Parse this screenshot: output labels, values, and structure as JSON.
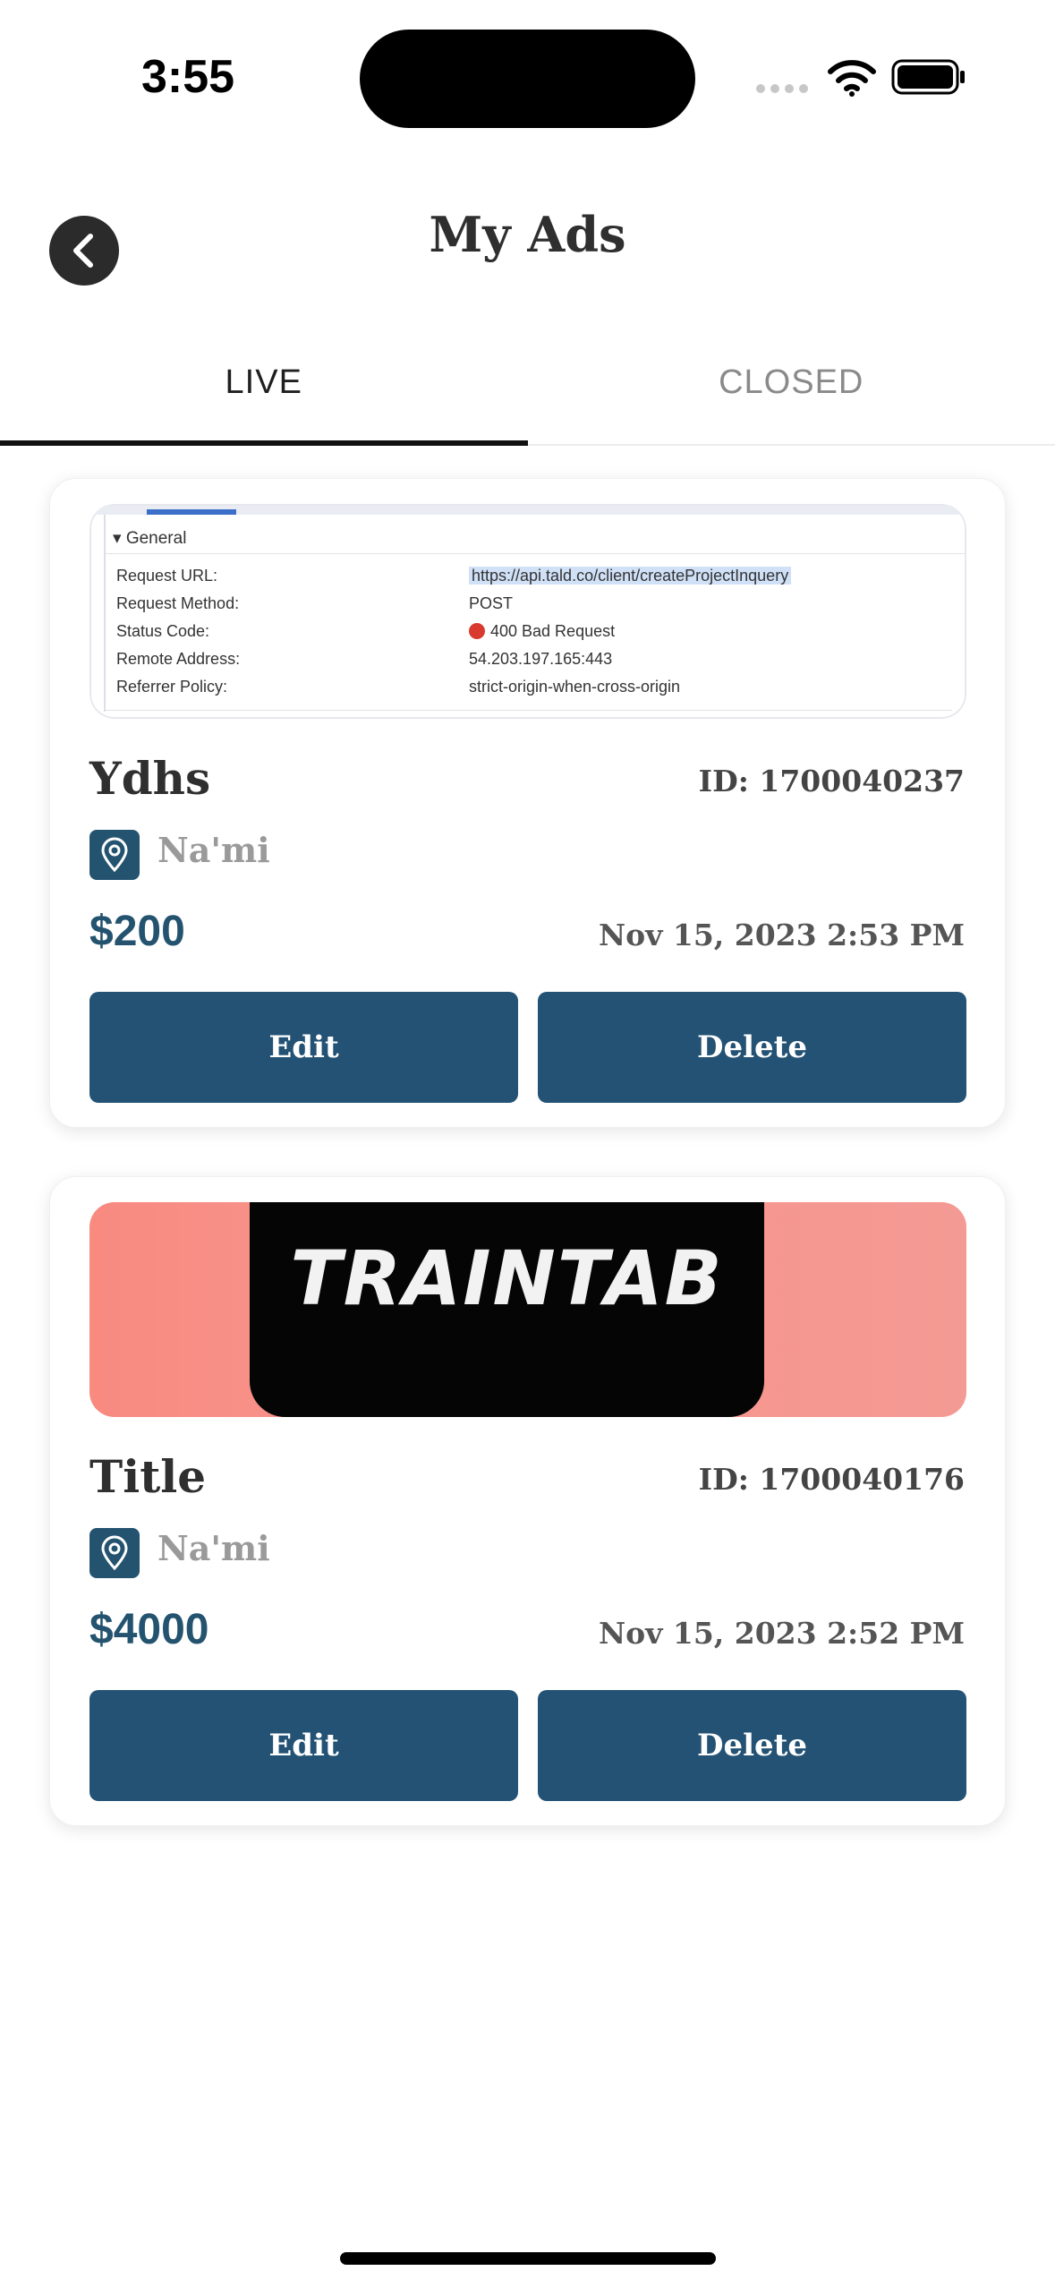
{
  "status_bar": {
    "time": "3:55"
  },
  "header": {
    "title": "My Ads"
  },
  "tabs": [
    {
      "label": "LIVE",
      "active": true
    },
    {
      "label": "CLOSED",
      "active": false
    }
  ],
  "ads": [
    {
      "title": "Ydhs",
      "id_text": "ID: 1700040237",
      "location": "Na'mi",
      "price": "$200",
      "date": "Nov 15, 2023 2:53 PM",
      "edit_label": "Edit",
      "delete_label": "Delete",
      "image": {
        "header": "▾ General",
        "rows": [
          {
            "label": "Request URL:",
            "value": "https://api.tald.co/client/createProjectInquery"
          },
          {
            "label": "Request Method:",
            "value": "POST"
          },
          {
            "label": "Status Code:",
            "value": "400 Bad Request"
          },
          {
            "label": "Remote Address:",
            "value": "54.203.197.165:443"
          },
          {
            "label": "Referrer Policy:",
            "value": "strict-origin-when-cross-origin"
          }
        ]
      }
    },
    {
      "title": "Title",
      "id_text": "ID: 1700040176",
      "location": "Na'mi",
      "price": "$4000",
      "date": "Nov 15, 2023 2:52 PM",
      "edit_label": "Edit",
      "delete_label": "Delete",
      "image": {
        "banner_text": "TRAINTAB"
      }
    }
  ],
  "colors": {
    "accent": "#235274",
    "status_red": "#d93a2f"
  },
  "icons": [
    "wifi-icon",
    "battery-icon",
    "back-chevron-icon",
    "location-pin-icon"
  ]
}
